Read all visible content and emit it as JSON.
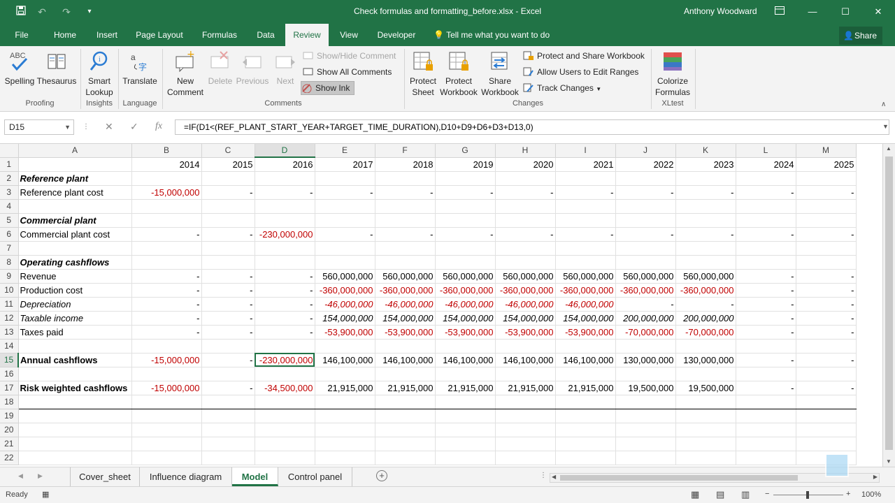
{
  "app": {
    "window_title": "Check formulas and formatting_before.xlsx - Excel",
    "user": "Anthony Woodward",
    "share_label": "Share",
    "tell_me": "Tell me what you want to do"
  },
  "tabs": [
    "File",
    "Home",
    "Insert",
    "Page Layout",
    "Formulas",
    "Data",
    "Review",
    "View",
    "Developer"
  ],
  "active_tab": "Review",
  "ribbon": {
    "proofing": {
      "spelling": "Spelling",
      "thesaurus": "Thesaurus",
      "label": "Proofing"
    },
    "insights": {
      "smart": "Smart",
      "lookup": "Lookup",
      "label": "Insights"
    },
    "language": {
      "translate": "Translate",
      "label": "Language"
    },
    "comments": {
      "new1": "New",
      "new2": "Comment",
      "delete": "Delete",
      "previous": "Previous",
      "next": "Next",
      "show_hide": "Show/Hide Comment",
      "show_all": "Show All Comments",
      "show_ink": "Show Ink",
      "label": "Comments"
    },
    "changes": {
      "protect_sheet1": "Protect",
      "protect_sheet2": "Sheet",
      "protect_wb1": "Protect",
      "protect_wb2": "Workbook",
      "share_wb1": "Share",
      "share_wb2": "Workbook",
      "protect_share": "Protect and Share Workbook",
      "allow_users": "Allow Users to Edit Ranges",
      "track_changes": "Track Changes",
      "label": "Changes"
    },
    "xltest": {
      "colorize1": "Colorize",
      "colorize2": "Formulas",
      "label": "XLtest"
    }
  },
  "formula_bar": {
    "name_box": "D15",
    "formula": "=IF(D1<(REF_PLANT_START_YEAR+TARGET_TIME_DURATION),D10+D9+D6+D3+D13,0)"
  },
  "grid": {
    "columns": [
      "A",
      "B",
      "C",
      "D",
      "E",
      "F",
      "G",
      "H",
      "I",
      "J",
      "K",
      "L",
      "M"
    ],
    "rows": [
      {
        "n": "1",
        "cells": [
          "",
          "2014",
          "2015",
          "2016",
          "2017",
          "2018",
          "2019",
          "2020",
          "2021",
          "2022",
          "2023",
          "2024",
          "2025"
        ]
      },
      {
        "n": "2",
        "cells": [
          "Reference plant",
          "",
          "",
          "",
          "",
          "",
          "",
          "",
          "",
          "",
          "",
          "",
          ""
        ]
      },
      {
        "n": "3",
        "cells": [
          "Reference plant cost",
          "-15,000,000",
          "-",
          "-",
          "-",
          "-",
          "-",
          "-",
          "-",
          "-",
          "-",
          "-",
          "-"
        ]
      },
      {
        "n": "4",
        "cells": [
          "",
          "",
          "",
          "",
          "",
          "",
          "",
          "",
          "",
          "",
          "",
          "",
          ""
        ]
      },
      {
        "n": "5",
        "cells": [
          "Commercial plant",
          "",
          "",
          "",
          "",
          "",
          "",
          "",
          "",
          "",
          "",
          "",
          ""
        ]
      },
      {
        "n": "6",
        "cells": [
          "Commercial plant cost",
          "-",
          "-",
          "-230,000,000",
          "-",
          "-",
          "-",
          "-",
          "-",
          "-",
          "-",
          "-",
          "-"
        ]
      },
      {
        "n": "7",
        "cells": [
          "",
          "",
          "",
          "",
          "",
          "",
          "",
          "",
          "",
          "",
          "",
          "",
          ""
        ]
      },
      {
        "n": "8",
        "cells": [
          "Operating cashflows",
          "",
          "",
          "",
          "",
          "",
          "",
          "",
          "",
          "",
          "",
          "",
          ""
        ]
      },
      {
        "n": "9",
        "cells": [
          "Revenue",
          "-",
          "-",
          "-",
          "560,000,000",
          "560,000,000",
          "560,000,000",
          "560,000,000",
          "560,000,000",
          "560,000,000",
          "560,000,000",
          "-",
          "-"
        ]
      },
      {
        "n": "10",
        "cells": [
          "Production cost",
          "-",
          "-",
          "-",
          "-360,000,000",
          "-360,000,000",
          "-360,000,000",
          "-360,000,000",
          "-360,000,000",
          "-360,000,000",
          "-360,000,000",
          "-",
          "-"
        ]
      },
      {
        "n": "11",
        "cells": [
          "Depreciation",
          "-",
          "-",
          "-",
          "-46,000,000",
          "-46,000,000",
          "-46,000,000",
          "-46,000,000",
          "-46,000,000",
          "-",
          "-",
          "-",
          "-"
        ]
      },
      {
        "n": "12",
        "cells": [
          "Taxable income",
          "-",
          "-",
          "-",
          "154,000,000",
          "154,000,000",
          "154,000,000",
          "154,000,000",
          "154,000,000",
          "200,000,000",
          "200,000,000",
          "-",
          "-"
        ]
      },
      {
        "n": "13",
        "cells": [
          "Taxes paid",
          "-",
          "-",
          "-",
          "-53,900,000",
          "-53,900,000",
          "-53,900,000",
          "-53,900,000",
          "-53,900,000",
          "-70,000,000",
          "-70,000,000",
          "-",
          "-"
        ]
      },
      {
        "n": "14",
        "cells": [
          "",
          "",
          "",
          "",
          "",
          "",
          "",
          "",
          "",
          "",
          "",
          "",
          ""
        ]
      },
      {
        "n": "15",
        "cells": [
          "Annual cashflows",
          "-15,000,000",
          "-",
          "-230,000,000",
          "146,100,000",
          "146,100,000",
          "146,100,000",
          "146,100,000",
          "146,100,000",
          "130,000,000",
          "130,000,000",
          "-",
          "-"
        ]
      },
      {
        "n": "16",
        "cells": [
          "",
          "",
          "",
          "",
          "",
          "",
          "",
          "",
          "",
          "",
          "",
          "",
          ""
        ]
      },
      {
        "n": "17",
        "cells": [
          "Risk weighted cashflows",
          "-15,000,000",
          "-",
          "-34,500,000",
          "21,915,000",
          "21,915,000",
          "21,915,000",
          "21,915,000",
          "21,915,000",
          "19,500,000",
          "19,500,000",
          "-",
          "-"
        ]
      },
      {
        "n": "18",
        "cells": [
          "",
          "",
          "",
          "",
          "",
          "",
          "",
          "",
          "",
          "",
          "",
          "",
          ""
        ]
      },
      {
        "n": "19",
        "cells": [
          "",
          "",
          "",
          "",
          "",
          "",
          "",
          "",
          "",
          "",
          "",
          "",
          ""
        ]
      },
      {
        "n": "20",
        "cells": [
          "",
          "",
          "",
          "",
          "",
          "",
          "",
          "",
          "",
          "",
          "",
          "",
          ""
        ]
      },
      {
        "n": "21",
        "cells": [
          "",
          "",
          "",
          "",
          "",
          "",
          "",
          "",
          "",
          "",
          "",
          "",
          ""
        ]
      },
      {
        "n": "22",
        "cells": [
          "",
          "",
          "",
          "",
          "",
          "",
          "",
          "",
          "",
          "",
          "",
          "",
          ""
        ]
      }
    ],
    "active_cell": "D15"
  },
  "sheets": [
    "Cover_sheet",
    "Influence diagram",
    "Model",
    "Control panel"
  ],
  "active_sheet": "Model",
  "status": {
    "ready": "Ready",
    "zoom": "100%"
  },
  "colors": {
    "excel_green": "#217346",
    "negative_red": "#c00000"
  }
}
